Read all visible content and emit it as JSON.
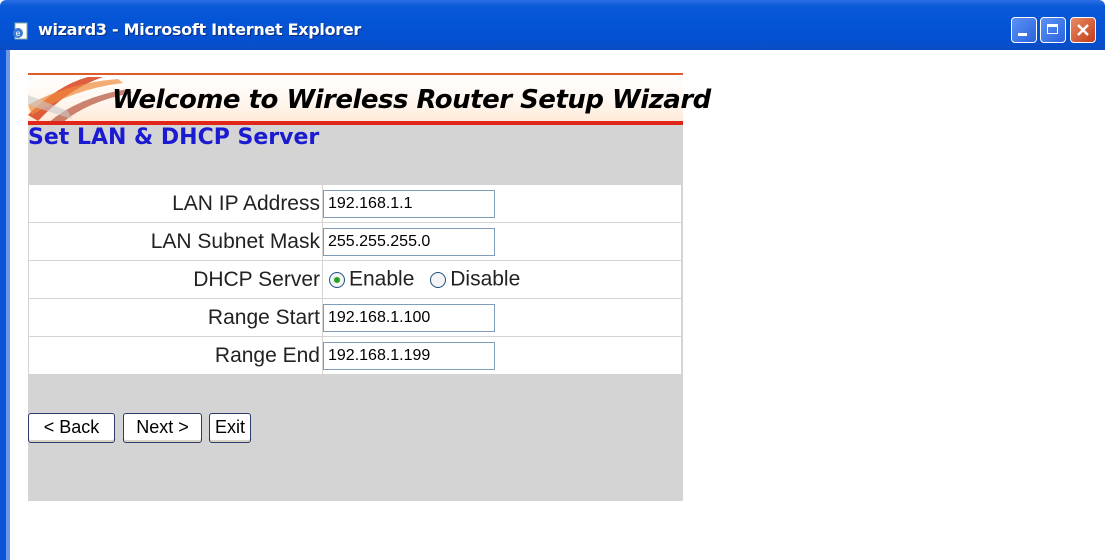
{
  "window": {
    "title": "wizard3 - Microsoft Internet Explorer",
    "app_icon": "ie-page-icon",
    "controls": [
      "minimize-icon",
      "maximize-icon",
      "close-icon"
    ]
  },
  "banner": {
    "title": "Welcome to Wireless Router Setup Wizard"
  },
  "section": {
    "title": "Set LAN & DHCP Server"
  },
  "form": {
    "lan_ip": {
      "label": "LAN IP Address",
      "value": "192.168.1.1"
    },
    "subnet": {
      "label": "LAN Subnet Mask",
      "value": "255.255.255.0"
    },
    "dhcp": {
      "label": "DHCP Server",
      "options": [
        "Enable",
        "Disable"
      ],
      "selected": "Enable"
    },
    "range_start": {
      "label": "Range Start",
      "value": "192.168.1.100"
    },
    "range_end": {
      "label": "Range End",
      "value": "192.168.1.199"
    }
  },
  "buttons": {
    "back": "< Back",
    "next": "Next >",
    "exit": "Exit"
  },
  "colors": {
    "titlebar": "#0455d6",
    "section_title": "#1a1ad0",
    "panel_bg": "#d4d4d4",
    "banner_accent": "#e0251b",
    "radio_selected": "#21a121"
  }
}
